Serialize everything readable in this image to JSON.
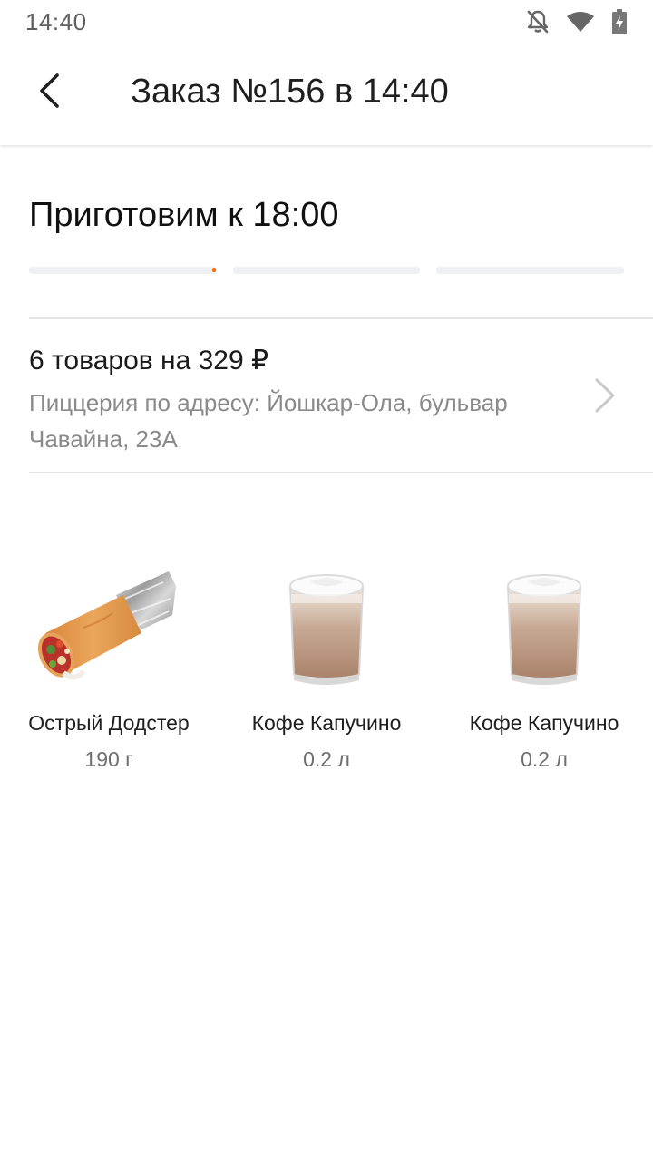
{
  "status_bar": {
    "time": "14:40",
    "icons": [
      "bell-off-icon",
      "wifi-icon",
      "battery-charging-icon"
    ]
  },
  "app_bar": {
    "title": "Заказ №156 в 14:40",
    "back_icon": "chevron-left-icon"
  },
  "order": {
    "ready_heading": "Приготовим к 18:00",
    "progress": {
      "segments": 3,
      "current_segment_fraction": 1.0,
      "track_color": "#eef0f4",
      "accent_color": "#ff6900"
    },
    "summary": {
      "title": "6 товаров на 329 ₽",
      "address": "Пиццерия по адресу: Йошкар-Ола, бульвар Чавайна, 23А",
      "chevron_icon": "chevron-right-icon"
    }
  },
  "products": [
    {
      "name": "Острый Додстер",
      "size": "190 г",
      "image": "wrap-image"
    },
    {
      "name": "Кофе Капучино",
      "size": "0.2 л",
      "image": "coffee-cup-image"
    },
    {
      "name": "Кофе Капучино",
      "size": "0.2 л",
      "image": "coffee-cup-image"
    }
  ]
}
